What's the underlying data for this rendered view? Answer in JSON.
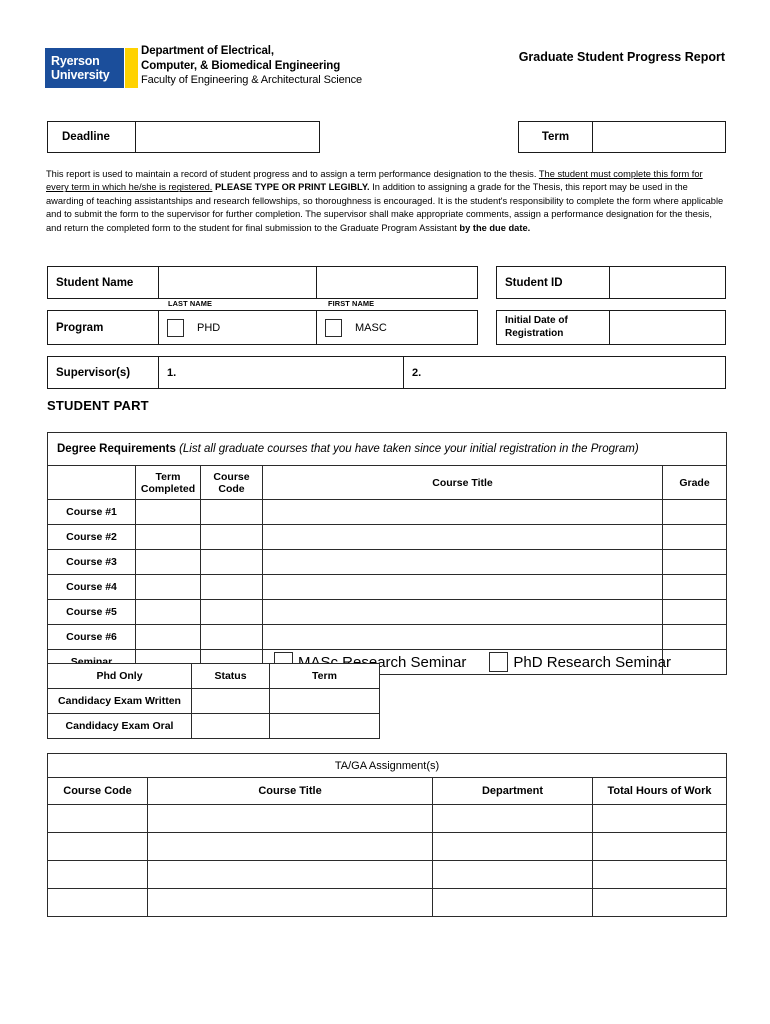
{
  "header": {
    "logo": {
      "line1": "Ryerson",
      "line2": "University"
    },
    "department_line1": "Department of Electrical,",
    "department_line2": "Computer, & Biomedical Engineering",
    "faculty_line": "Faculty of Engineering & Architectural Science",
    "doc_title": "Graduate Student Progress Report",
    "brand_blue": "#1b4e9b",
    "brand_yellow": "#ffd200"
  },
  "top_fields": {
    "deadline_label": "Deadline",
    "deadline_value": "",
    "term_label": "Term",
    "term_value": ""
  },
  "intro": {
    "p1": "This report is used to maintain a record of student progress and to assign a term performance designation to the thesis. ",
    "u1": "The student must complete this form for every term in which he/she is registered.",
    "b1": " PLEASE TYPE OR PRINT LEGIBLY.",
    "p2": " In addition to assigning a grade for the Thesis, this report may be used in the awarding of teaching assistantships and research fellowships, so thoroughness is encouraged. It is the student's responsibility to complete the form where applicable and to submit the form to the supervisor for further completion. The supervisor shall make appropriate comments, assign a performance designation for the thesis, and return the completed form to the student for final submission to the Graduate Program Assistant ",
    "b2": "by the due date."
  },
  "student_info": {
    "student_name_label": "Student Name",
    "last_name_value": "",
    "first_name_value": "",
    "last_name_caption": "LAST NAME",
    "first_name_caption": "FIRST NAME",
    "student_id_label": "Student ID",
    "student_id_value": "",
    "program_label": "Program",
    "program_option_1": "PHD",
    "program_option_2": "MASC",
    "initial_date_label_line1": "Initial Date of",
    "initial_date_label_line2": "Registration",
    "initial_date_value": "",
    "supervisors_label": "Supervisor(s)",
    "supervisor_1": "1.",
    "supervisor_2": "2."
  },
  "section_heading": "STUDENT PART",
  "degree_requirements": {
    "banner_bold": "Degree Requirements",
    "banner_italic": " (List all graduate courses that you have taken since your initial registration in the Program)",
    "headers": [
      "",
      "Term\nCompleted",
      "Course\nCode",
      "Course Title",
      "Grade"
    ],
    "header_term_l1": "Term",
    "header_term_l2": "Completed",
    "header_code_l1": "Course",
    "header_code_l2": "Code",
    "header_title": "Course Title",
    "header_grade": "Grade",
    "rows": [
      {
        "label": "Course #1",
        "term": "",
        "code": "",
        "title": "",
        "grade": ""
      },
      {
        "label": "Course #2",
        "term": "",
        "code": "",
        "title": "",
        "grade": ""
      },
      {
        "label": "Course #3",
        "term": "",
        "code": "",
        "title": "",
        "grade": ""
      },
      {
        "label": "Course #4",
        "term": "",
        "code": "",
        "title": "",
        "grade": ""
      },
      {
        "label": "Course #5",
        "term": "",
        "code": "",
        "title": "",
        "grade": ""
      },
      {
        "label": "Course #6",
        "term": "",
        "code": "",
        "title": "",
        "grade": ""
      }
    ],
    "seminar_label": "Seminar",
    "seminar_option_1": "MASc Research Seminar",
    "seminar_option_2": "PhD Research Seminar",
    "seminar_term": "",
    "seminar_code": "",
    "seminar_grade": ""
  },
  "phd_only": {
    "headers": [
      "Phd Only",
      "Status",
      "Term"
    ],
    "rows": [
      {
        "label": "Candidacy Exam Written",
        "status": "",
        "term": ""
      },
      {
        "label": "Candidacy Exam Oral",
        "status": "",
        "term": ""
      }
    ]
  },
  "taga": {
    "banner": "TA/GA Assignment(s)",
    "headers": [
      "Course Code",
      "Course Title",
      "Department",
      "Total Hours of Work"
    ],
    "rows": [
      {
        "code": "",
        "title": "",
        "department": "",
        "hours": ""
      },
      {
        "code": "",
        "title": "",
        "department": "",
        "hours": ""
      },
      {
        "code": "",
        "title": "",
        "department": "",
        "hours": ""
      },
      {
        "code": "",
        "title": "",
        "department": "",
        "hours": ""
      }
    ]
  }
}
